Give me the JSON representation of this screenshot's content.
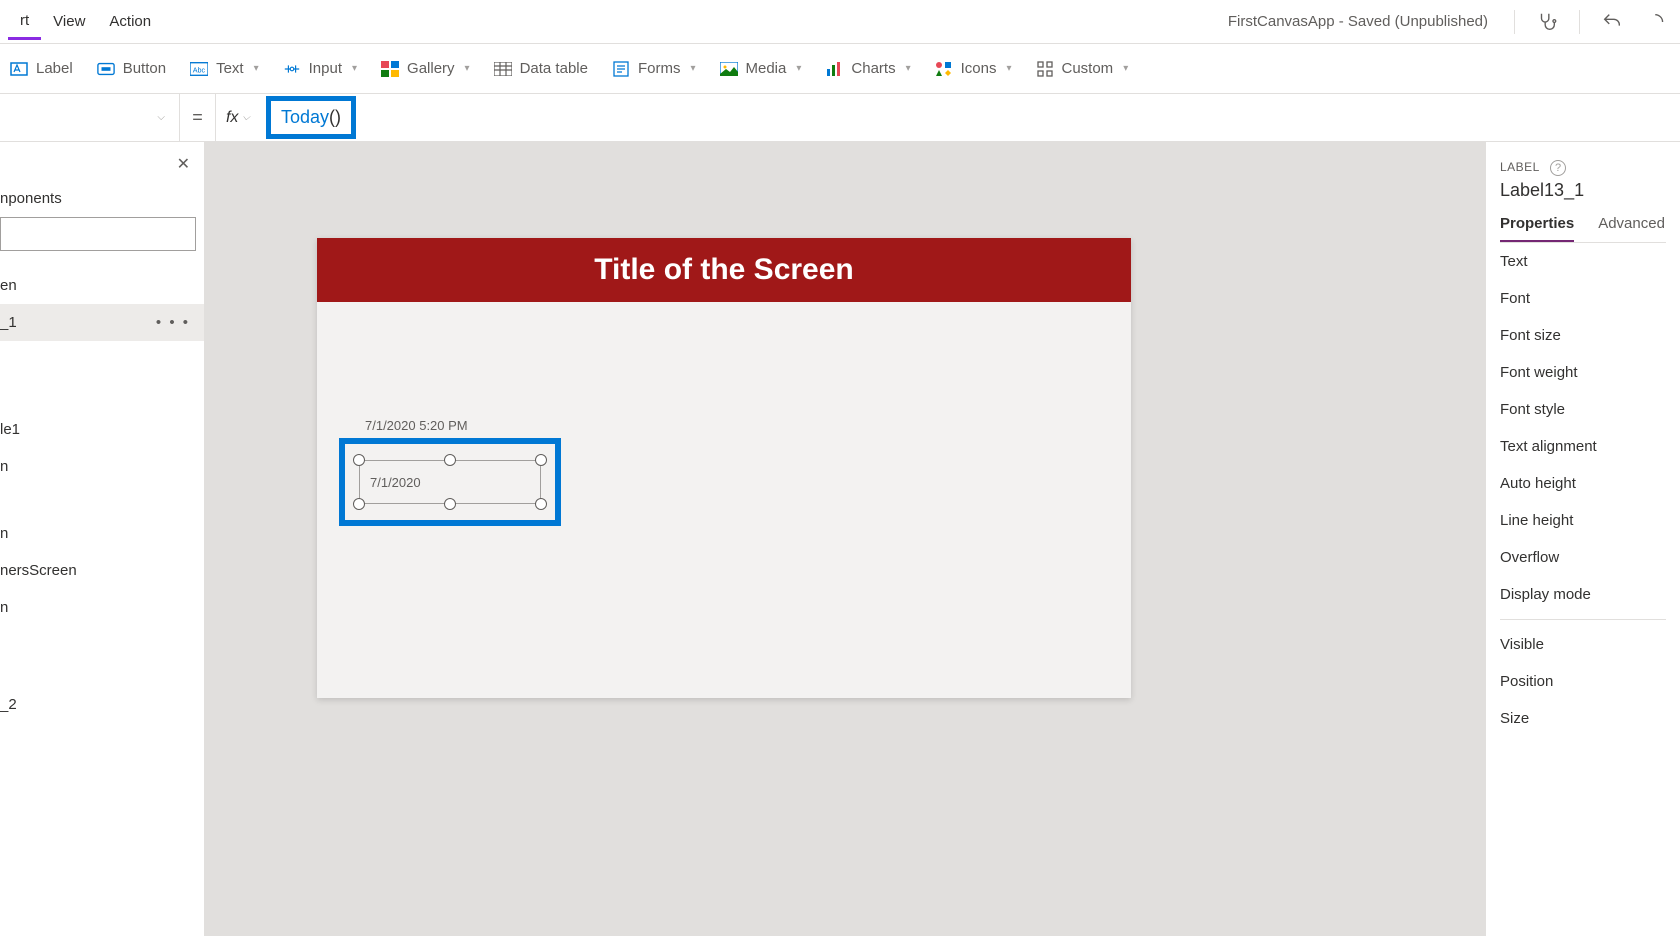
{
  "menubar": {
    "items": [
      "rt",
      "View",
      "Action"
    ],
    "app_status": "FirstCanvasApp - Saved (Unpublished)"
  },
  "ribbon": {
    "label": "Label",
    "button": "Button",
    "text": "Text",
    "input": "Input",
    "gallery": "Gallery",
    "data_table": "Data table",
    "forms": "Forms",
    "media": "Media",
    "charts": "Charts",
    "icons": "Icons",
    "custom": "Custom"
  },
  "formula": {
    "eq": "=",
    "fx": "fx",
    "func": "Today",
    "parens": "()"
  },
  "left_panel": {
    "section": "nponents",
    "items": [
      "en",
      "_1",
      "le1",
      "n",
      "n",
      "nersScreen",
      "n",
      "_2"
    ]
  },
  "canvas": {
    "title": "Title of the Screen",
    "label_static": "7/1/2020 5:20 PM",
    "label_selected": "7/1/2020"
  },
  "right_panel": {
    "type": "LABEL",
    "name": "Label13_1",
    "tabs": {
      "properties": "Properties",
      "advanced": "Advanced"
    },
    "props": [
      "Text",
      "Font",
      "Font size",
      "Font weight",
      "Font style",
      "Text alignment",
      "Auto height",
      "Line height",
      "Overflow",
      "Display mode"
    ],
    "props2": [
      "Visible",
      "Position",
      "Size"
    ]
  }
}
